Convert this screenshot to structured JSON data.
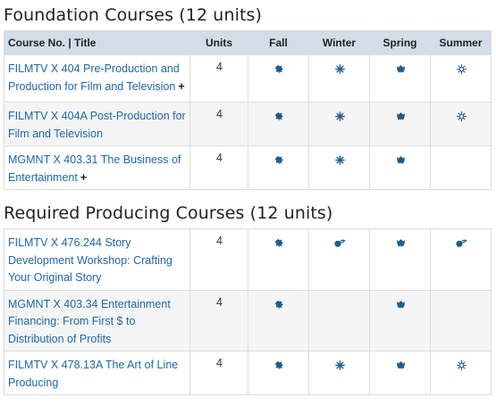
{
  "sections": [
    {
      "title": "Foundation Courses (12 units)",
      "columns": [
        "Course No. | Title",
        "Units",
        "Fall",
        "Winter",
        "Spring",
        "Summer"
      ],
      "rows": [
        {
          "title": "FILMTV X 404 Pre-Production and Production for Film and Television",
          "plus": "+",
          "units": "4",
          "fall": "leaf-icon",
          "winter": "snowflake-icon",
          "spring": "flower-icon",
          "summer": "sun-icon"
        },
        {
          "title": "FILMTV X 404A Post-Production for Film and Television",
          "plus": "",
          "units": "4",
          "fall": "leaf-icon",
          "winter": "snowflake-icon",
          "spring": "flower-icon",
          "summer": "sun-icon"
        },
        {
          "title": "MGMNT X 403.31 The Business of Entertainment",
          "plus": "+",
          "units": "4",
          "fall": "leaf-icon",
          "winter": "snowflake-icon",
          "spring": "flower-icon",
          "summer": ""
        }
      ]
    },
    {
      "title": "Required Producing Courses (12 units)",
      "columns": [
        "Course No. | Title",
        "Units",
        "Fall",
        "Winter",
        "Spring",
        "Summer"
      ],
      "rows": [
        {
          "title": "FILMTV X 476.244 Story Development Workshop: Crafting Your Original Story",
          "plus": "",
          "units": "4",
          "fall": "leaf-icon",
          "winter": "online-icon",
          "spring": "flower-icon",
          "summer": "online-icon"
        },
        {
          "title": "MGMNT X 403.34 Entertainment Financing: From First $ to Distribution of Profits",
          "plus": "",
          "units": "4",
          "fall": "leaf-icon",
          "winter": "",
          "spring": "flower-icon",
          "summer": ""
        },
        {
          "title": "FILMTV X 478.13A The Art of Line Producing",
          "plus": "",
          "units": "4",
          "fall": "leaf-icon",
          "winter": "snowflake-icon",
          "spring": "flower-icon",
          "summer": "sun-icon"
        }
      ]
    }
  ],
  "colors": {
    "header_bg": "#d3dde8",
    "link": "#1f67a8",
    "icon": "#1f5d8c",
    "row_alt": "#f5f5f5"
  }
}
